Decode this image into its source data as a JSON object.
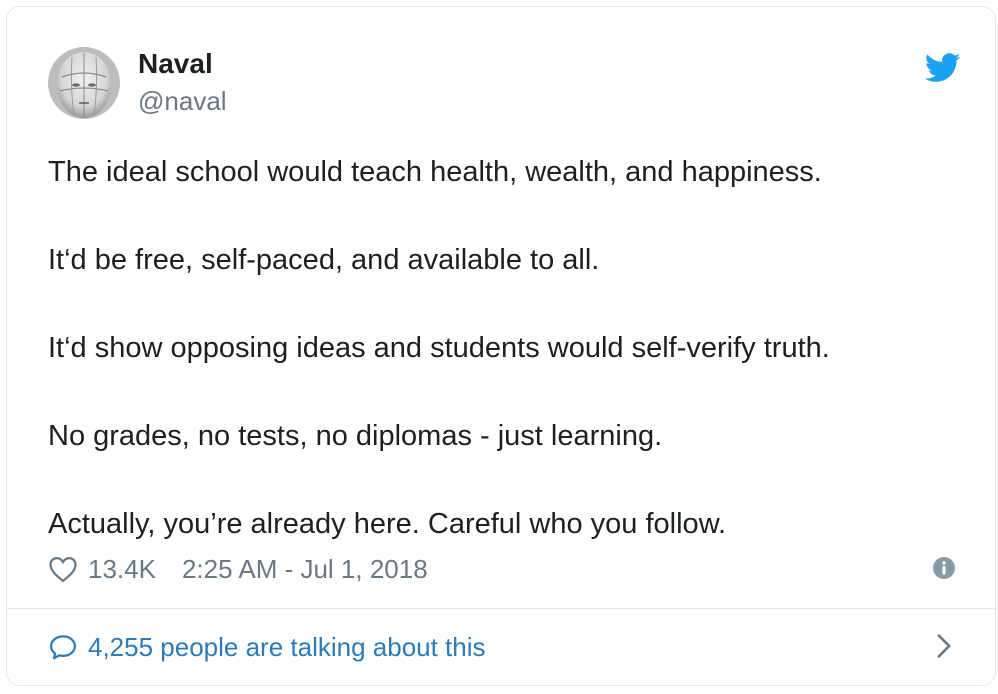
{
  "author": {
    "name": "Naval",
    "handle": "@naval"
  },
  "tweet": {
    "paragraphs": [
      "The ideal school would teach health, wealth, and happiness.",
      "It‘d be free, self-paced, and available to all.",
      "It‘d show opposing ideas and students would self-verify truth.",
      "No grades, no tests, no diplomas - just learning.",
      "Actually, you’re already here. Careful who you follow."
    ],
    "like_count": "13.4K",
    "timestamp": "2:25 AM - Jul 1, 2018"
  },
  "footer": {
    "conversation_label": "4,255 people are talking about this"
  },
  "colors": {
    "twitter_blue": "#1da1f2",
    "link_blue": "#2b7bb9",
    "secondary_text": "#697882",
    "border": "#e1e8ed"
  },
  "icons": {
    "brand": "twitter-bird-icon",
    "like": "heart-icon",
    "info": "info-icon",
    "conversation": "speech-bubble-icon",
    "chevron": "chevron-right-icon"
  }
}
